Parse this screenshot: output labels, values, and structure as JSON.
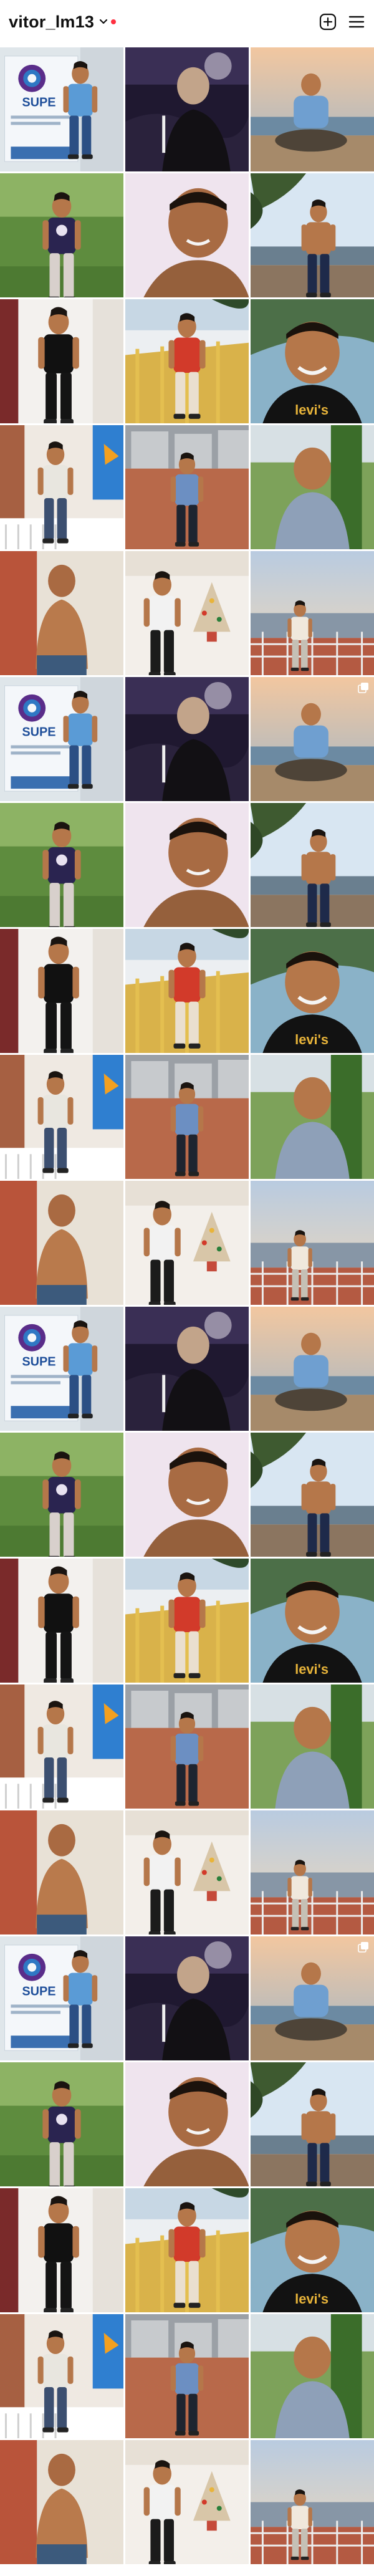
{
  "header": {
    "username": "vitor_lm13"
  },
  "icons": {
    "chevron": "chevron-down-icon",
    "new_post": "add-post-icon",
    "menu": "menu-icon"
  },
  "colors": {
    "notification_dot": "#ff3040",
    "text": "#111111",
    "background": "#ffffff"
  },
  "grid": {
    "columns": 3,
    "posts": [
      {
        "scene": "banner",
        "multi": false
      },
      {
        "scene": "night",
        "multi": false
      },
      {
        "scene": "sunset-sit",
        "multi": false
      },
      {
        "scene": "lawn",
        "multi": false
      },
      {
        "scene": "closeup",
        "multi": false
      },
      {
        "scene": "riverbank",
        "multi": false
      },
      {
        "scene": "blackshirt",
        "multi": false
      },
      {
        "scene": "railing",
        "multi": false
      },
      {
        "scene": "smile",
        "multi": false
      },
      {
        "scene": "bench",
        "multi": false
      },
      {
        "scene": "street",
        "multi": false
      },
      {
        "scene": "greyshirt",
        "multi": false
      },
      {
        "scene": "shirtless",
        "multi": false
      },
      {
        "scene": "xmas",
        "multi": false
      },
      {
        "scene": "pier",
        "multi": false
      },
      {
        "scene": "banner",
        "multi": false
      },
      {
        "scene": "night",
        "multi": false
      },
      {
        "scene": "sunset-sit",
        "multi": true
      },
      {
        "scene": "lawn",
        "multi": false
      },
      {
        "scene": "closeup",
        "multi": false
      },
      {
        "scene": "riverbank",
        "multi": false
      },
      {
        "scene": "blackshirt",
        "multi": false
      },
      {
        "scene": "railing",
        "multi": false
      },
      {
        "scene": "smile",
        "multi": false
      },
      {
        "scene": "bench",
        "multi": false
      },
      {
        "scene": "street",
        "multi": false
      },
      {
        "scene": "greyshirt",
        "multi": false
      },
      {
        "scene": "shirtless",
        "multi": false
      },
      {
        "scene": "xmas",
        "multi": false
      },
      {
        "scene": "pier",
        "multi": false
      },
      {
        "scene": "banner",
        "multi": false
      },
      {
        "scene": "night",
        "multi": false
      },
      {
        "scene": "sunset-sit",
        "multi": false
      },
      {
        "scene": "lawn",
        "multi": false
      },
      {
        "scene": "closeup",
        "multi": false
      },
      {
        "scene": "riverbank",
        "multi": false
      },
      {
        "scene": "blackshirt",
        "multi": false
      },
      {
        "scene": "railing",
        "multi": false
      },
      {
        "scene": "smile",
        "multi": false
      },
      {
        "scene": "bench",
        "multi": false
      },
      {
        "scene": "street",
        "multi": false
      },
      {
        "scene": "greyshirt",
        "multi": false
      },
      {
        "scene": "shirtless",
        "multi": false
      },
      {
        "scene": "xmas",
        "multi": false
      },
      {
        "scene": "pier",
        "multi": false
      },
      {
        "scene": "banner",
        "multi": false
      },
      {
        "scene": "night",
        "multi": false
      },
      {
        "scene": "sunset-sit",
        "multi": true
      },
      {
        "scene": "lawn",
        "multi": false
      },
      {
        "scene": "closeup",
        "multi": false
      },
      {
        "scene": "riverbank",
        "multi": false
      },
      {
        "scene": "blackshirt",
        "multi": false
      },
      {
        "scene": "railing",
        "multi": false
      },
      {
        "scene": "smile",
        "multi": false
      },
      {
        "scene": "bench",
        "multi": false
      },
      {
        "scene": "street",
        "multi": false
      },
      {
        "scene": "greyshirt",
        "multi": false
      },
      {
        "scene": "shirtless",
        "multi": false
      },
      {
        "scene": "xmas",
        "multi": false
      },
      {
        "scene": "pier",
        "multi": false
      }
    ]
  }
}
